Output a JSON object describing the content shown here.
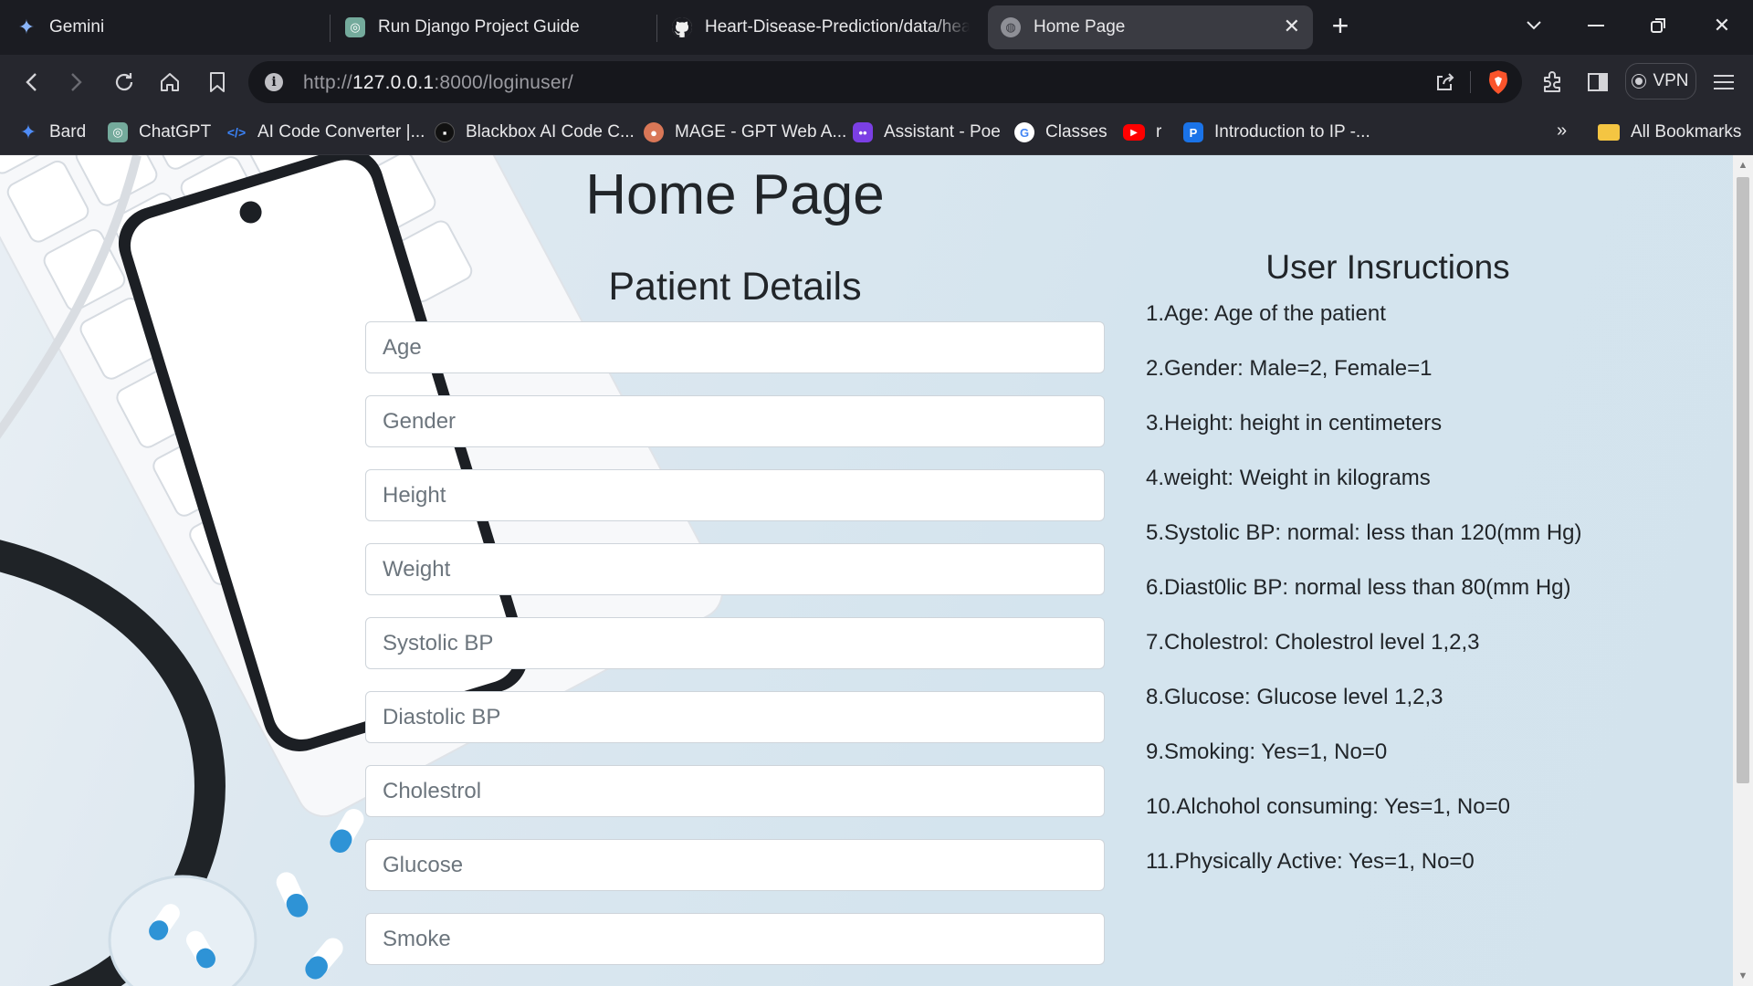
{
  "browser": {
    "tabs": [
      {
        "title": "Gemini",
        "icon": "gemini-icon",
        "active": false
      },
      {
        "title": "Run Django Project Guide",
        "icon": "chatgpt-icon",
        "active": false
      },
      {
        "title": "Heart-Disease-Prediction/data/heart",
        "icon": "github-icon",
        "active": false
      },
      {
        "title": "Home Page",
        "icon": "globe-icon",
        "active": true
      }
    ],
    "url_scheme": "http://",
    "url_host": "127.0.0.1",
    "url_rest": ":8000/loginuser/",
    "vpn_label": "VPN",
    "bookmarks": [
      {
        "label": "Bard",
        "icon": "bard-icon",
        "color": "#4f8cf7"
      },
      {
        "label": "ChatGPT",
        "icon": "chatgpt-icon",
        "color": "#74aa9c"
      },
      {
        "label": "AI Code Converter |...",
        "icon": "code-icon",
        "color": "#3b82f6"
      },
      {
        "label": "Blackbox AI Code C...",
        "icon": "blackbox-icon",
        "color": "#111111"
      },
      {
        "label": "MAGE - GPT Web A...",
        "icon": "mage-icon",
        "color": "#d97757"
      },
      {
        "label": "Assistant - Poe",
        "icon": "poe-icon",
        "color": "#7b3fe4"
      },
      {
        "label": "Classes",
        "icon": "google-icon",
        "color": "#ffffff"
      },
      {
        "label": "r",
        "icon": "youtube-icon",
        "color": "#ff0000"
      },
      {
        "label": "Introduction to IP -...",
        "icon": "p-icon",
        "color": "#1a73e8"
      }
    ],
    "all_bookmarks_label": "All Bookmarks",
    "overflow_label": "»"
  },
  "page": {
    "title": "Home Page",
    "form": {
      "title": "Patient Details",
      "fields": [
        {
          "placeholder": "Age"
        },
        {
          "placeholder": "Gender"
        },
        {
          "placeholder": "Height"
        },
        {
          "placeholder": "Weight"
        },
        {
          "placeholder": "Systolic BP"
        },
        {
          "placeholder": "Diastolic BP"
        },
        {
          "placeholder": "Cholestrol"
        },
        {
          "placeholder": "Glucose"
        },
        {
          "placeholder": "Smoke"
        }
      ]
    },
    "instructions": {
      "title": "User Insructions",
      "items": [
        "1.Age: Age of the patient",
        "2.Gender: Male=2, Female=1",
        "3.Height: height in centimeters",
        "4.weight: Weight in kilograms",
        "5.Systolic BP: normal: less than 120(mm Hg)",
        "6.Diast0lic BP: normal less than 80(mm Hg)",
        "7.Cholestrol: Cholestrol level 1,2,3",
        "8.Glucose: Glucose level 1,2,3",
        "9.Smoking: Yes=1, No=0",
        "10.Alchohol consuming: Yes=1, No=0",
        "11.Physically Active: Yes=1, No=0"
      ]
    }
  }
}
